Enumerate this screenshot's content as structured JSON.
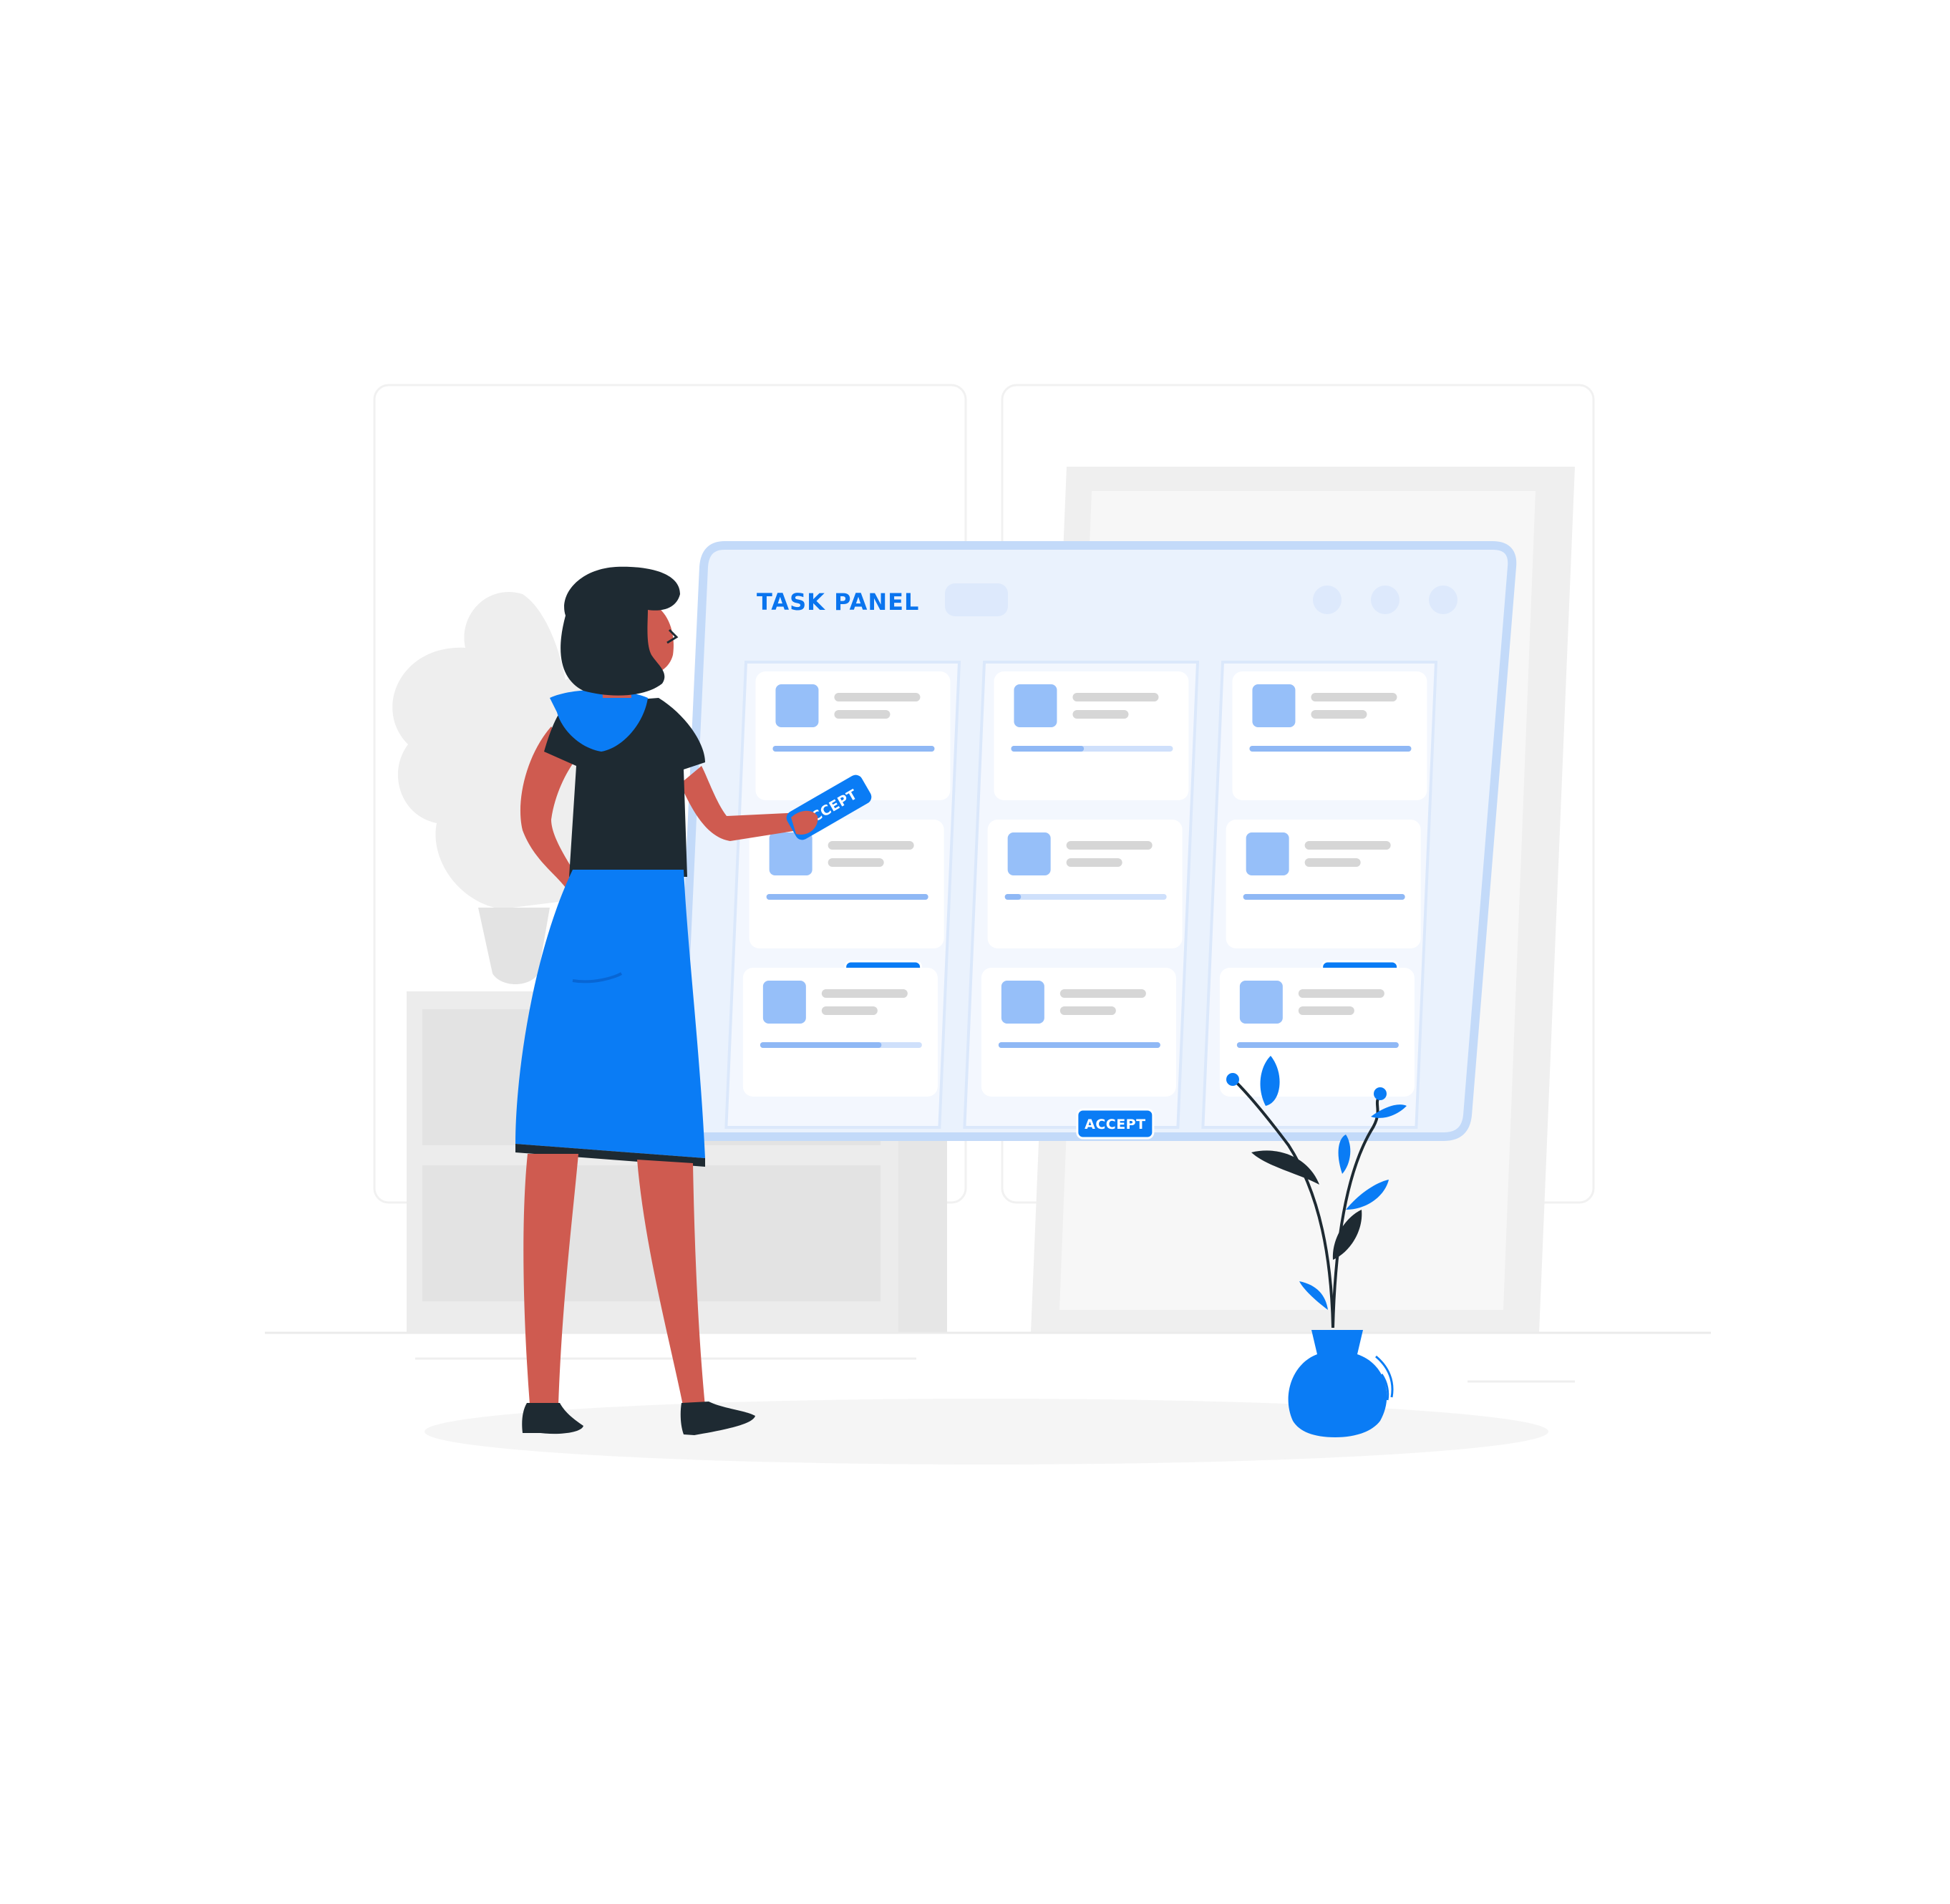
{
  "panel": {
    "title": "TASK PANEL"
  },
  "accept_label": "ACCEPT",
  "columns": [
    {
      "cards": [
        {
          "progress": 1.0,
          "button": false
        },
        {
          "progress": 1.0,
          "button": true
        },
        {
          "progress": 0.75,
          "button": false
        }
      ]
    },
    {
      "cards": [
        {
          "progress": 0.45,
          "button": false
        },
        {
          "progress": 0.1,
          "button": false
        },
        {
          "progress": 1.0,
          "button": true
        }
      ]
    },
    {
      "cards": [
        {
          "progress": 1.0,
          "button": false
        },
        {
          "progress": 1.0,
          "button": true
        },
        {
          "progress": 1.0,
          "button": false
        }
      ]
    }
  ],
  "held_card_label": "ACCEPT",
  "colors": {
    "accent": "#0a7cf5",
    "panel_bg": "#eaf2fd",
    "panel_border": "#c3daf9",
    "tile": "#96bff9",
    "skin": "#cf5b50",
    "dark": "#1e2a32"
  },
  "icons": [
    "window-dot-icon",
    "window-dot-icon",
    "window-dot-icon",
    "plant-icon",
    "vase-icon",
    "person-illustration"
  ]
}
